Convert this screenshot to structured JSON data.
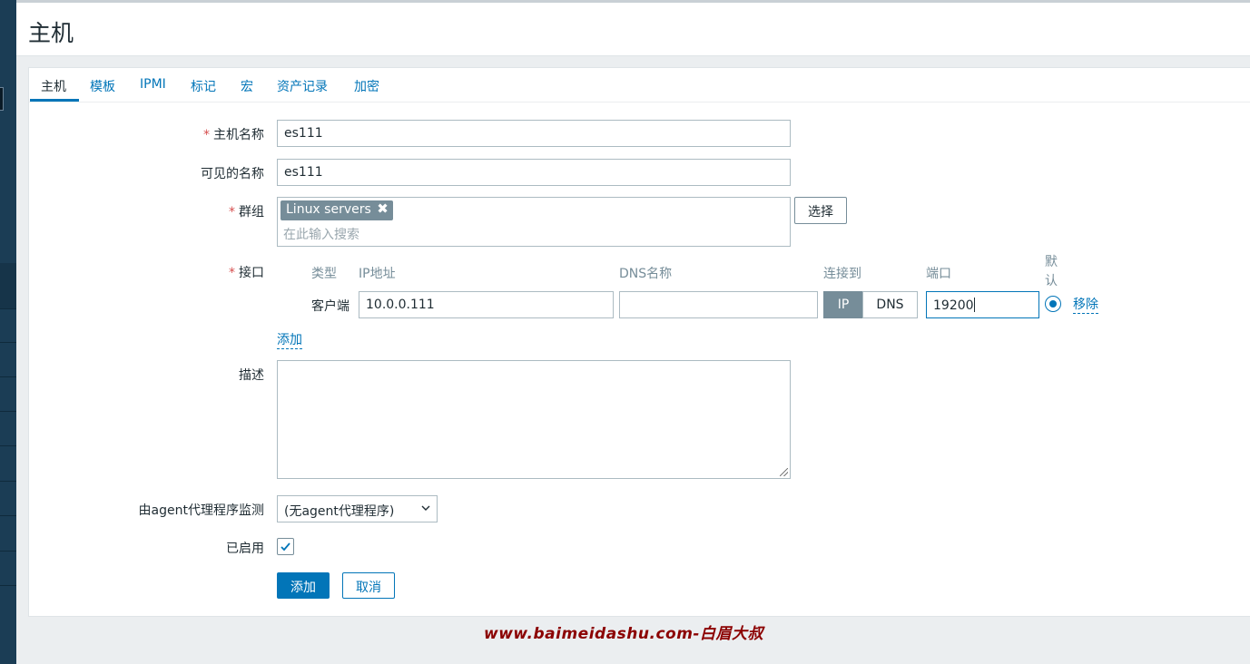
{
  "page": {
    "title": "主机"
  },
  "tabs": [
    {
      "label": "主机"
    },
    {
      "label": "模板"
    },
    {
      "label": "IPMI"
    },
    {
      "label": "标记"
    },
    {
      "label": "宏"
    },
    {
      "label": "资产记录"
    },
    {
      "label": "加密"
    }
  ],
  "form": {
    "required_mark": "*",
    "host_name": {
      "label": "主机名称",
      "value": "es111"
    },
    "visible_name": {
      "label": "可见的名称",
      "value": "es111"
    },
    "groups": {
      "label": "群组",
      "chip": "Linux servers",
      "chip_remove": "✖",
      "placeholder": "在此输入搜索",
      "select_button": "选择"
    },
    "interfaces": {
      "label": "接口",
      "headers": {
        "type": "类型",
        "ip": "IP地址",
        "dns": "DNS名称",
        "connect": "连接到",
        "port": "端口",
        "default": "默认"
      },
      "row": {
        "type": "客户端",
        "ip": "10.0.0.111",
        "dns": "",
        "connect_ip": "IP",
        "connect_dns": "DNS",
        "port": "19200",
        "remove": "移除"
      },
      "add": "添加"
    },
    "description": {
      "label": "描述",
      "value": ""
    },
    "proxy": {
      "label": "由agent代理程序监测",
      "value": "(无agent代理程序)"
    },
    "enabled": {
      "label": "已启用",
      "checked": true
    },
    "buttons": {
      "add": "添加",
      "cancel": "取消"
    }
  },
  "watermark": "www.baimeidashu.com-白眉大叔",
  "colors": {
    "accent": "#0275b8",
    "sidebar": "#1b3d55",
    "required": "#d64e4e",
    "chip": "#768d99",
    "watermark": "#8b0000"
  },
  "icons": {
    "chip_remove": "close-icon",
    "select_arrow": "chevron-down-icon",
    "checkbox": "check-icon"
  }
}
